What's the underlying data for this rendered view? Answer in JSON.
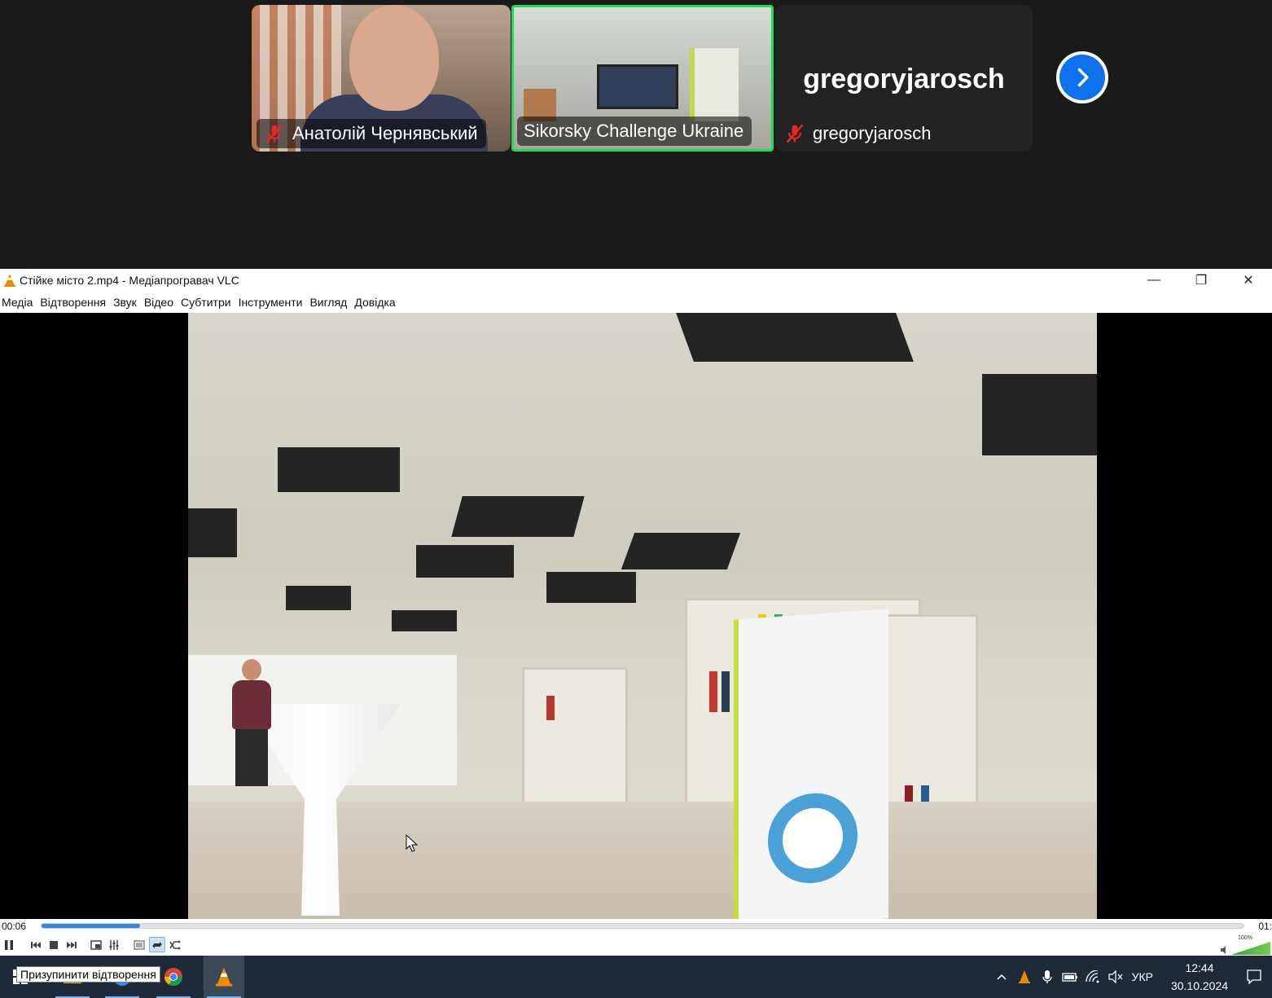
{
  "zoom": {
    "participants": [
      {
        "name": "Анатолій Чернявський",
        "muted": true
      },
      {
        "name": "Sikorsky Challenge Ukraine",
        "muted": false,
        "active_speaker": true
      },
      {
        "name": "gregoryjarosch",
        "display_name": "gregoryjarosch",
        "muted": true
      }
    ],
    "next_page_icon": "chevron-right-icon",
    "colors": {
      "active_border": "#23d959",
      "next_button": "#0e72ed",
      "muted_icon": "#e02828"
    }
  },
  "vlc": {
    "title": "Стійке місто 2.mp4 - Медіапрогравач VLC",
    "menu": [
      "Медіа",
      "Відтворення",
      "Звук",
      "Відео",
      "Субтитри",
      "Інструменти",
      "Вигляд",
      "Довідка"
    ],
    "window_buttons": {
      "minimize": "—",
      "restore": "❐",
      "close": "✕"
    },
    "time_elapsed": "00:06",
    "time_total": "01:",
    "progress": 0.082,
    "volume_label": "100%",
    "controls": [
      "pause",
      "previous",
      "stop",
      "next",
      "fullscreen",
      "extended-settings",
      "playlist",
      "loop",
      "shuffle"
    ],
    "active_controls": [
      "loop"
    ],
    "accent": "#2f86da"
  },
  "taskbar": {
    "tooltip": "Призупинити відтворення",
    "language": "УКР",
    "time": "12:44",
    "date": "30.10.2024"
  }
}
